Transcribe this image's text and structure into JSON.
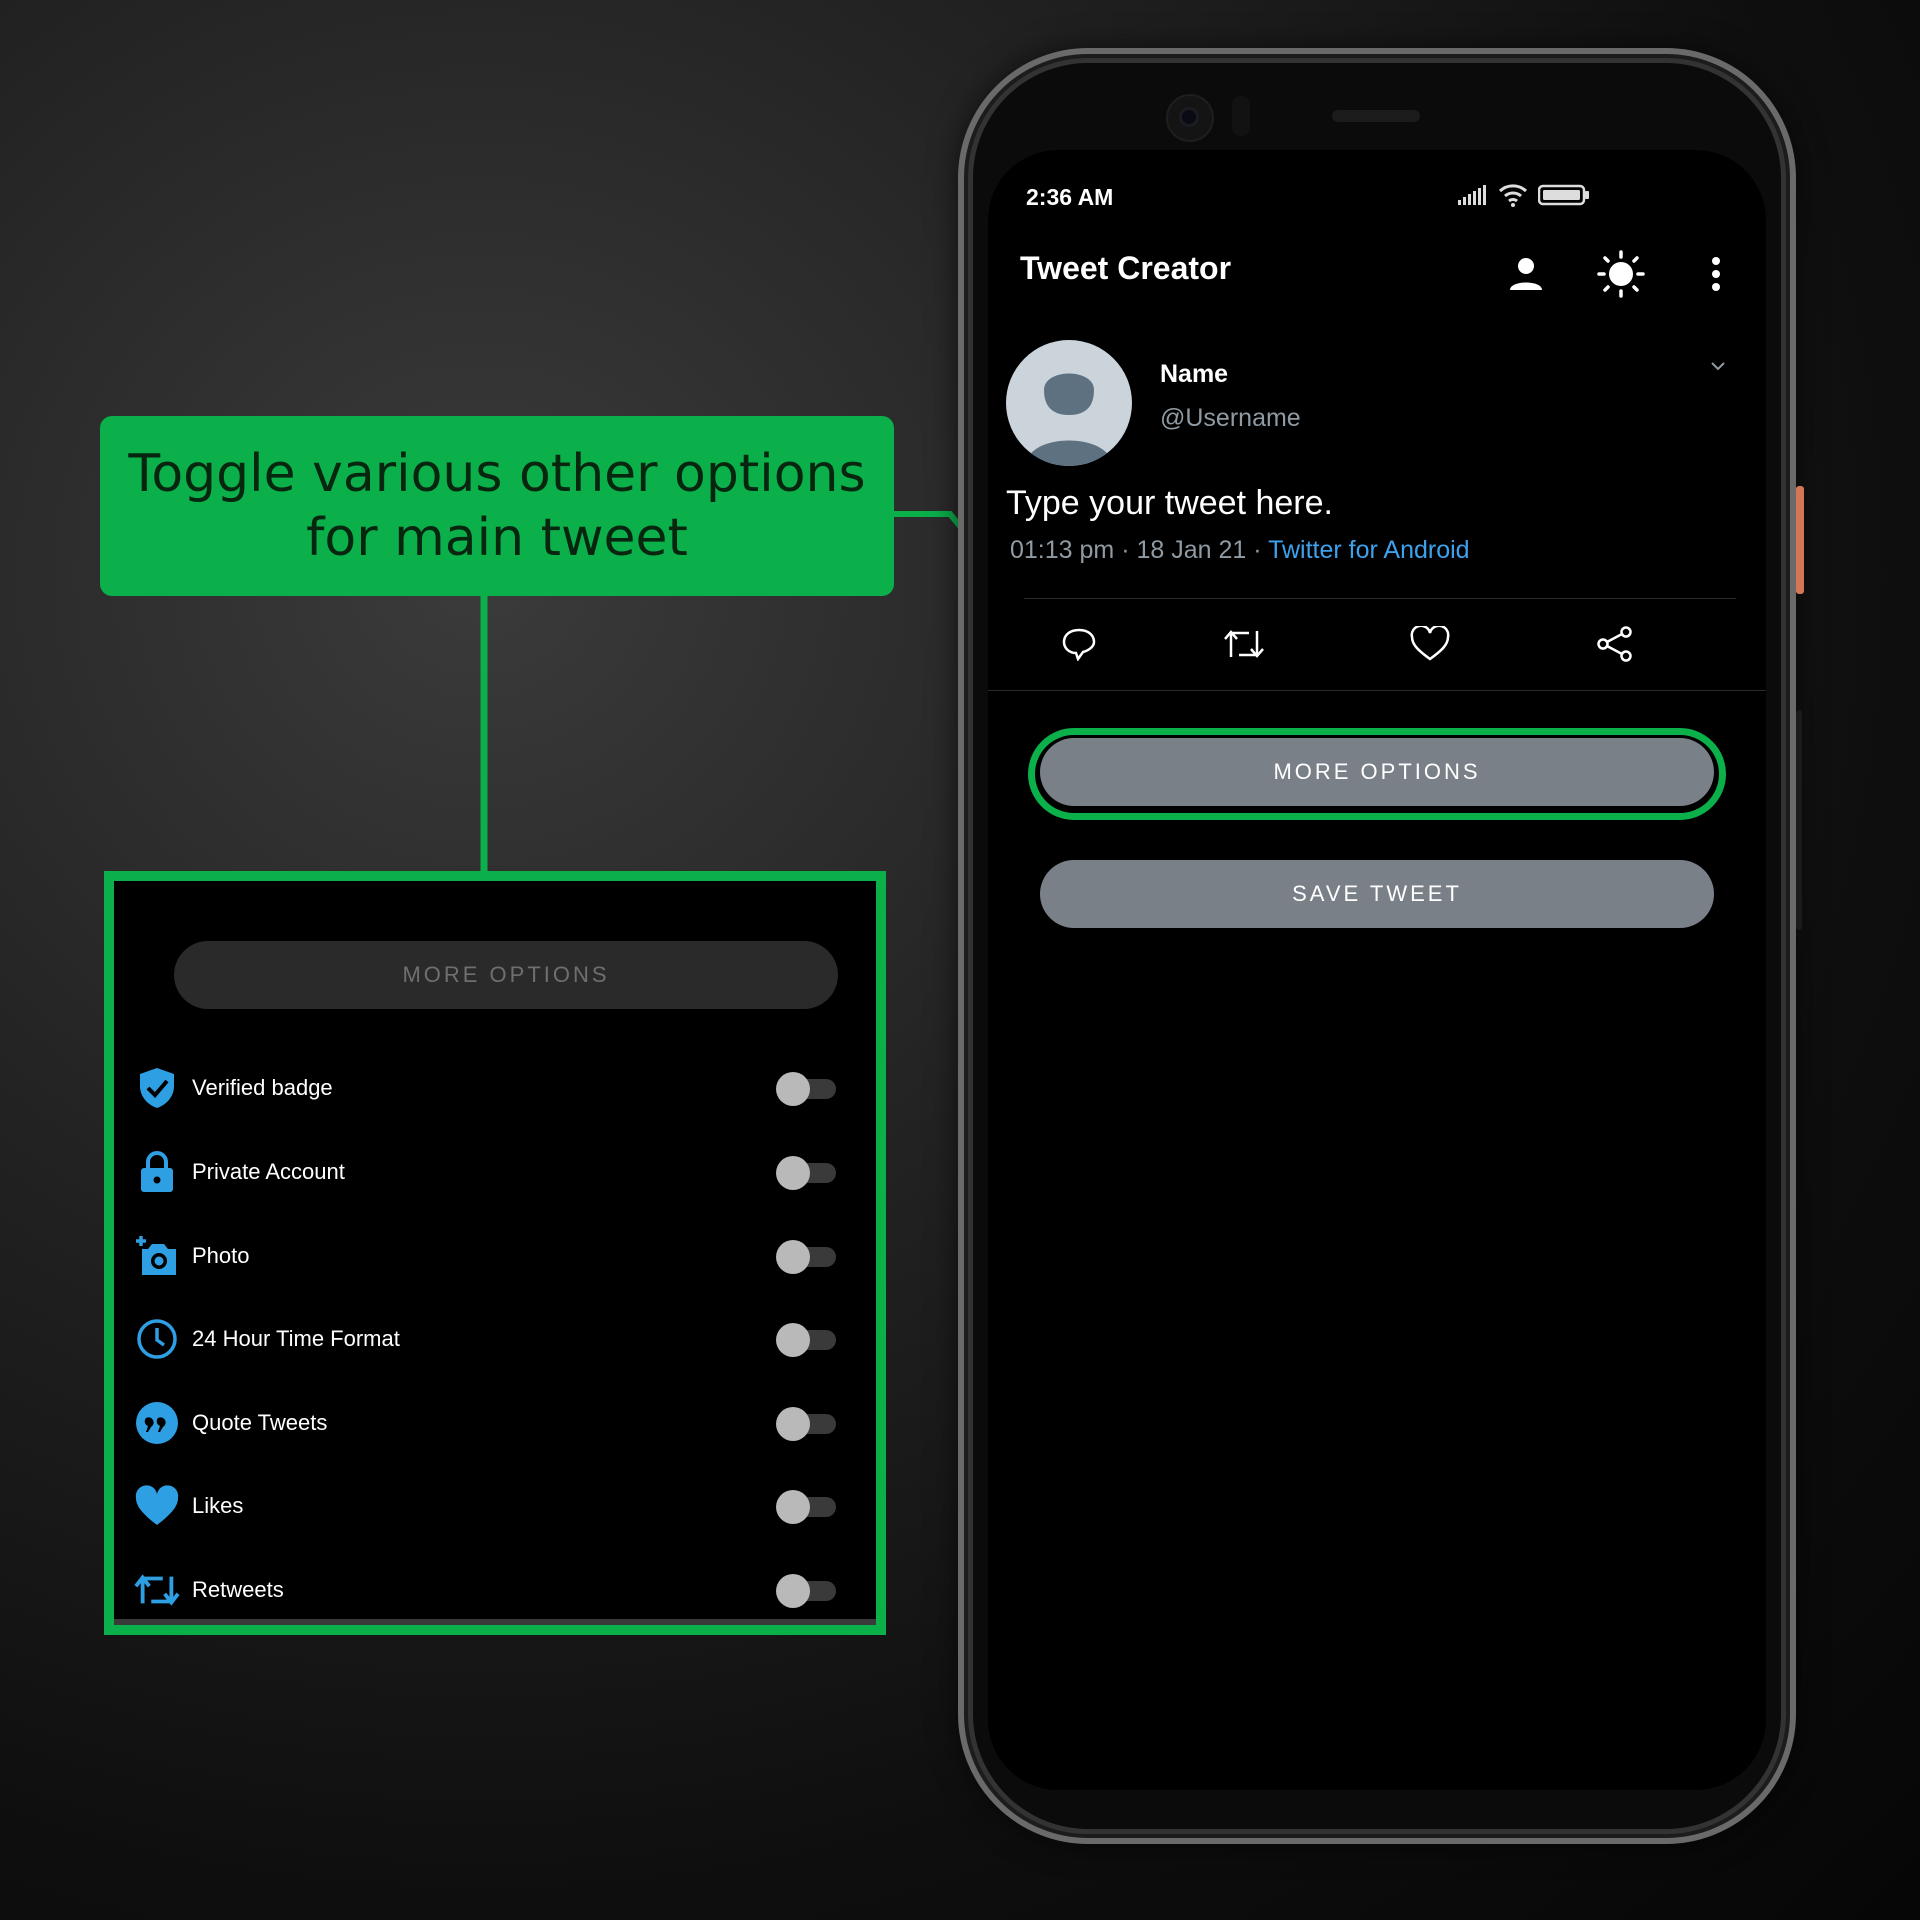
{
  "callout": {
    "line1": "Toggle various other options",
    "line2": "for main tweet"
  },
  "zoom_panel": {
    "more_options_label": "MORE OPTIONS",
    "options": [
      {
        "label": "Verified badge",
        "icon": "verified-shield-icon",
        "on": false
      },
      {
        "label": "Private Account",
        "icon": "lock-icon",
        "on": false
      },
      {
        "label": "Photo",
        "icon": "add-photo-icon",
        "on": false
      },
      {
        "label": "24 Hour Time Format",
        "icon": "clock-icon",
        "on": false
      },
      {
        "label": "Quote Tweets",
        "icon": "quote-icon",
        "on": false
      },
      {
        "label": "Likes",
        "icon": "heart-icon",
        "on": false
      },
      {
        "label": "Retweets",
        "icon": "retweet-icon",
        "on": false
      }
    ]
  },
  "status_bar": {
    "time": "2:36 AM"
  },
  "app_bar": {
    "title": "Tweet Creator",
    "icons": [
      "profile-icon",
      "brightness-icon",
      "overflow-menu-icon"
    ]
  },
  "tweet": {
    "name": "Name",
    "username": "@Username",
    "text": "Type your tweet here.",
    "time": "01:13 pm",
    "date": "18 Jan 21",
    "source": "Twitter for Android",
    "actions": [
      "reply-icon",
      "retweet-icon",
      "like-icon",
      "share-icon"
    ]
  },
  "buttons": {
    "more_options": "MORE OPTIONS",
    "save_tweet": "SAVE TWEET"
  },
  "colors": {
    "callout_green": "#0bb04a",
    "icon_blue": "#2f9fe3",
    "link_blue": "#3ea1ee",
    "button_gray": "#798088"
  }
}
